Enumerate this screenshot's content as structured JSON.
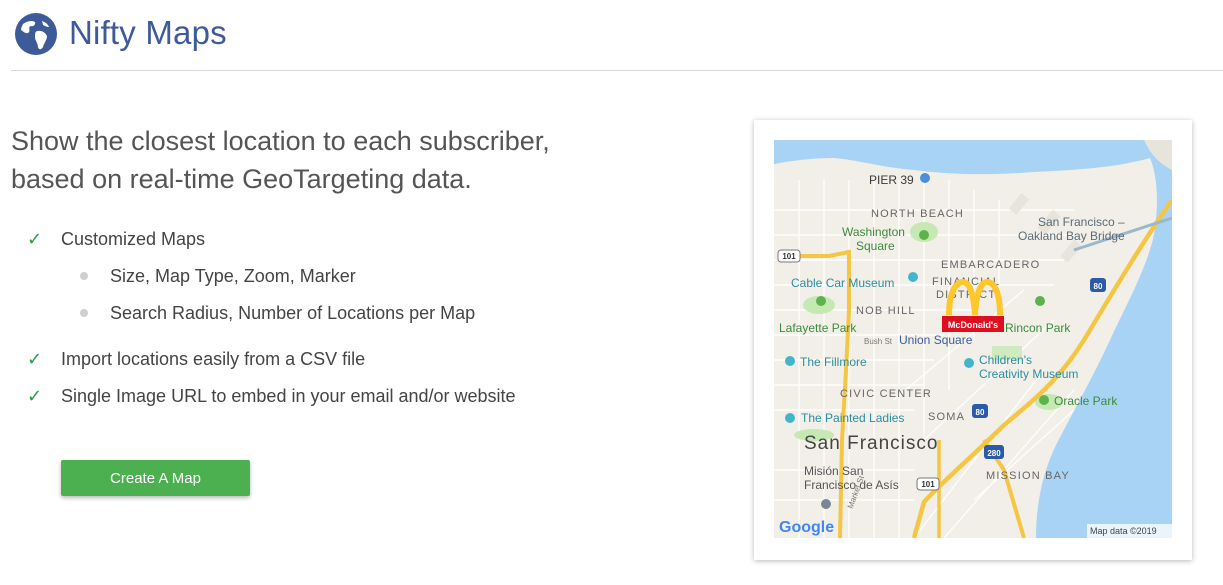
{
  "header": {
    "brand": "Nifty Maps",
    "logo_icon": "globe-icon"
  },
  "hero": {
    "headline_line1": "Show the closest location to each subscriber,",
    "headline_line2": "based on real-time GeoTargeting data."
  },
  "features": {
    "items": [
      {
        "label": "Customized Maps",
        "icon": "check-icon"
      },
      {
        "label": "Import locations easily from a CSV file",
        "icon": "check-icon"
      },
      {
        "label": "Single Image URL to embed in your email and/or website",
        "icon": "check-icon"
      }
    ],
    "sub_items": [
      {
        "label": "Size, Map Type, Zoom, Marker"
      },
      {
        "label": "Search Radius, Number of Locations per Map"
      }
    ]
  },
  "cta": {
    "label": "Create A Map",
    "color": "#4caf50"
  },
  "map": {
    "labels": {
      "pier39": "PIER 39",
      "north_beach": "NORTH BEACH",
      "sf_bridge_1": "San Francisco –",
      "sf_bridge_2": "Oakland Bay Bridge",
      "washington_1": "Washington",
      "washington_2": "Square",
      "embarcadero": "EMBARCADERO",
      "financial_1": "FINANCIAL",
      "financial_2": "DISTRICT",
      "cable_car": "Cable Car Museum",
      "nob_hill": "NOB HILL",
      "lafayette": "Lafayette Park",
      "rincon": "Rincon Park",
      "bush": "Bush St",
      "union_square": "Union Square",
      "fillmore": "The Fillmore",
      "childrens_1": "Children's",
      "childrens_2": "Creativity Museum",
      "civic": "CIVIC CENTER",
      "oracle": "Oracle Park",
      "painted": "The Painted Ladies",
      "soma": "SOMA",
      "city": "San Francisco",
      "mission_sf_1": "Misión San",
      "mission_sf_2": "Francisco de Asís",
      "mission_bay": "MISSION BAY",
      "hwy_101_a": "101",
      "hwy_101_b": "101",
      "hwy_80_a": "80",
      "hwy_80_b": "80",
      "hwy_280": "280",
      "market": "Market St",
      "google": "Google",
      "attribution": "Map data ©2019",
      "marker_text": "McDonald's"
    },
    "colors": {
      "water": "#a8d3f5",
      "land": "#f2efe9",
      "park": "#c6e8b3",
      "highway": "#f5c644",
      "marker_red": "#dd1021",
      "marker_gold": "#ffc72c"
    }
  }
}
